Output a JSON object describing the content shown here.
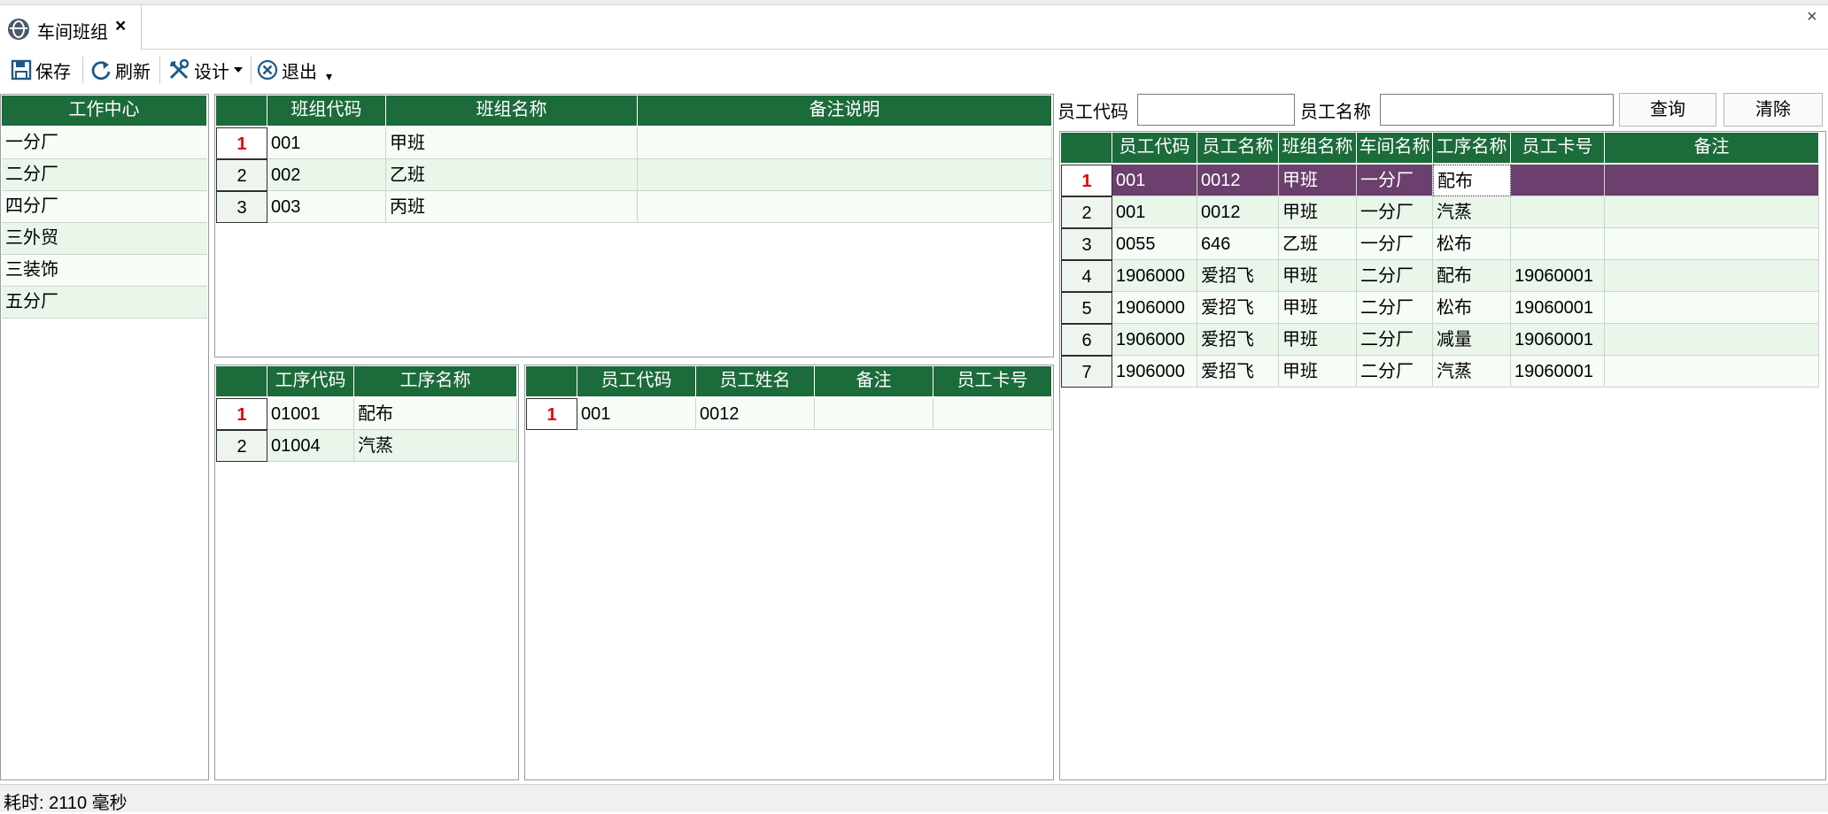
{
  "tab": {
    "title": "车间班组",
    "close": "×"
  },
  "window": {
    "close": "×"
  },
  "toolbar": {
    "save": "保存",
    "refresh": "刷新",
    "design": "设计",
    "exit": "退出"
  },
  "workcenter": {
    "header": "工作中心",
    "items": [
      "一分厂",
      "二分厂",
      "四分厂",
      "三外贸",
      "三装饰",
      "五分厂"
    ]
  },
  "groups": {
    "columns": [
      "班组代码",
      "班组名称",
      "备注说明"
    ],
    "rows": [
      {
        "no": "1",
        "code": "001",
        "name": "甲班",
        "note": ""
      },
      {
        "no": "2",
        "code": "002",
        "name": "乙班",
        "note": ""
      },
      {
        "no": "3",
        "code": "003",
        "name": "丙班",
        "note": ""
      }
    ]
  },
  "processes": {
    "columns": [
      "工序代码",
      "工序名称"
    ],
    "rows": [
      {
        "no": "1",
        "code": "01001",
        "name": "配布"
      },
      {
        "no": "2",
        "code": "01004",
        "name": "汽蒸"
      }
    ]
  },
  "members": {
    "columns": [
      "员工代码",
      "员工姓名",
      "备注",
      "员工卡号"
    ],
    "rows": [
      {
        "no": "1",
        "code": "001",
        "name": "0012",
        "note": "",
        "card": ""
      }
    ]
  },
  "search": {
    "emp_code_label": "员工代码",
    "emp_code_value": "",
    "emp_name_label": "员工名称",
    "emp_name_value": "",
    "query": "查询",
    "clear": "清除"
  },
  "employees": {
    "columns": [
      "员工代码",
      "员工名称",
      "班组名称",
      "车间名称",
      "工序名称",
      "员工卡号",
      "备注"
    ],
    "rows": [
      {
        "no": "1",
        "c": [
          "001",
          "0012",
          "甲班",
          "一分厂",
          "配布",
          "",
          ""
        ]
      },
      {
        "no": "2",
        "c": [
          "001",
          "0012",
          "甲班",
          "一分厂",
          "汽蒸",
          "",
          ""
        ]
      },
      {
        "no": "3",
        "c": [
          "0055",
          "646",
          "乙班",
          "一分厂",
          "松布",
          "",
          ""
        ]
      },
      {
        "no": "4",
        "c": [
          "1906000",
          "爱招飞",
          "甲班",
          "二分厂",
          "配布",
          "19060001",
          ""
        ]
      },
      {
        "no": "5",
        "c": [
          "1906000",
          "爱招飞",
          "甲班",
          "二分厂",
          "松布",
          "19060001",
          ""
        ]
      },
      {
        "no": "6",
        "c": [
          "1906000",
          "爱招飞",
          "甲班",
          "二分厂",
          "减量",
          "19060001",
          ""
        ]
      },
      {
        "no": "7",
        "c": [
          "1906000",
          "爱招飞",
          "甲班",
          "二分厂",
          "汽蒸",
          "19060001",
          ""
        ]
      }
    ]
  },
  "status": {
    "text": "耗时: 2110 毫秒"
  },
  "colors": {
    "header_green": "#1c6b3b",
    "selected_row": "#6b3f6e",
    "row_alt": "#eaf6ea",
    "current_marker": "#e60000"
  }
}
